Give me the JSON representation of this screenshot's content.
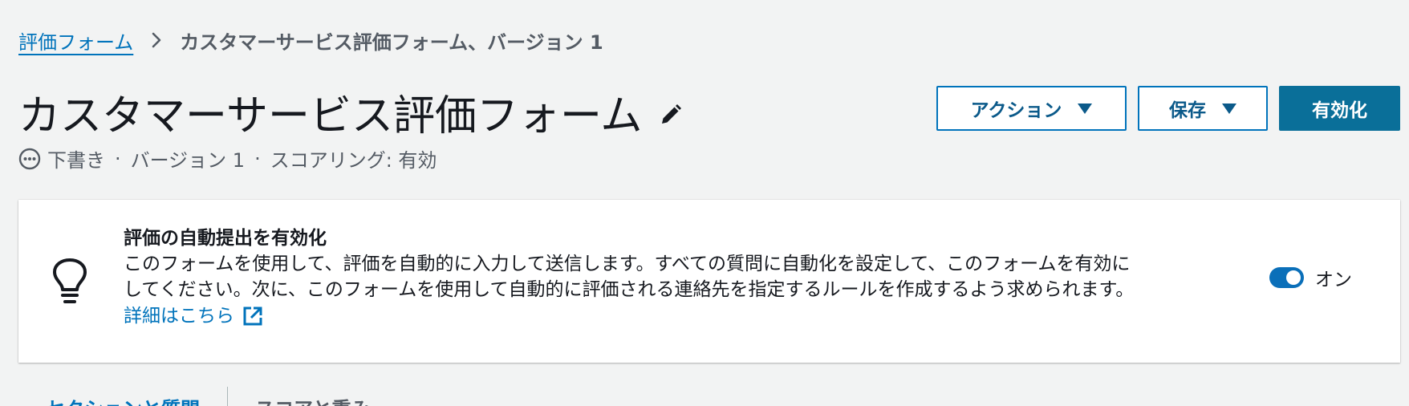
{
  "breadcrumb": {
    "parent": "評価フォーム",
    "current": "カスタマーサービス評価フォーム、バージョン 1"
  },
  "header": {
    "title": "カスタマーサービス評価フォーム",
    "status": "下書き",
    "version": "バージョン 1",
    "scoring": "スコアリング: 有効",
    "separator": "·"
  },
  "buttons": {
    "actions": "アクション",
    "save": "保存",
    "activate": "有効化"
  },
  "card": {
    "title": "評価の自動提出を有効化",
    "description_line1": "このフォームを使用して、評価を自動的に入力して送信します。すべての質問に自動化を設定して、このフォームを有効に",
    "description_line2": "してください。次に、このフォームを使用して自動的に評価される連絡先を指定するルールを作成するよう求められます。",
    "link": "詳細はこちら",
    "toggle_label": "オン",
    "toggle_on": true
  },
  "tabs": [
    {
      "label": "セクションと質問",
      "active": true
    },
    {
      "label": "スコアと重み",
      "active": false
    }
  ],
  "colors": {
    "link": "#0073bb",
    "primary": "#0a6f99",
    "background": "#f2f3f3",
    "toggle": "#0a6fb9"
  },
  "icons": {
    "breadcrumb_separator": "chevron-right-icon",
    "edit": "pencil-icon",
    "status": "draft-status-icon",
    "dropdown": "caret-down-icon",
    "tip": "lightbulb-icon",
    "external": "external-link-icon"
  }
}
